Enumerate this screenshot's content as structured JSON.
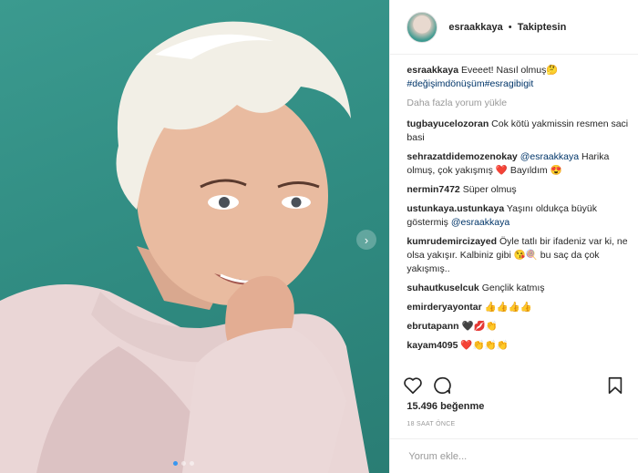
{
  "post": {
    "author": "esraakkaya",
    "bullet": "•",
    "follow_status": "Takiptesin",
    "caption_user": "esraakkaya",
    "caption_text": "Eveeet! Nasıl olmuş🤔",
    "caption_tags": "#değişimdönüşüm#esragibigit",
    "load_more": "Daha fazla yorum yükle",
    "likes": "15.496 beğenme",
    "time": "18 SAAT ÖNCE"
  },
  "comments": [
    {
      "user": "tugbayucelozoran",
      "text": "Cok kötü yakmissin resmen saci basi"
    },
    {
      "user": "sehrazatdidemozenokay",
      "mention": "@esraakkaya",
      "text": "Harika olmuş, çok yakışmış ❤️ Bayıldım 😍"
    },
    {
      "user": "nermin7472",
      "text": "Süper olmuş"
    },
    {
      "user": "ustunkaya.ustunkaya",
      "text": "Yaşını oldukça büyük göstermiş",
      "mention": "@esraakkaya"
    },
    {
      "user": "kumrudemircizayed",
      "text": "Öyle tatlı bir ifadeniz var ki, ne olsa yakışır. Kalbiniz gibi 😘🍭 bu saç da çok yakışmış.."
    },
    {
      "user": "suhautkuselcuk",
      "text": "Gençlik katmış"
    },
    {
      "user": "emirderyayontar",
      "text": "👍👍👍👍"
    },
    {
      "user": "ebrutapann",
      "text": "🖤💋👏"
    },
    {
      "user": "kayam4095",
      "text": "❤️👏👏👏"
    }
  ],
  "add_comment": {
    "placeholder": "Yorum ekle..."
  },
  "icons": {
    "like": "heart-icon",
    "comment": "comment-icon",
    "save": "bookmark-icon",
    "next": "chevron-right-icon"
  },
  "colors": {
    "accent": "#3897f0",
    "tag": "#003569",
    "background_teal": "#2f8a80"
  }
}
